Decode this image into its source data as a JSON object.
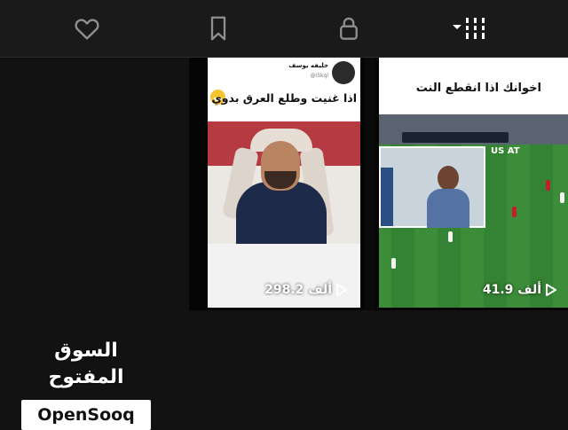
{
  "tabs": [
    {
      "icon": "heart-icon"
    },
    {
      "icon": "bookmark-icon"
    },
    {
      "icon": "lock-icon"
    },
    {
      "icon": "sort-columns-icon"
    }
  ],
  "colors": {
    "topbar": "#1a1a1a",
    "background": "#121212",
    "pitch": "#3b8d3a"
  },
  "videos": [
    {
      "views": "298.2 ألف",
      "tweet_author": "خليفه يوسف",
      "tweet_handle": "@i5kql",
      "tweet_text": "اذا غنيت وطلع العرق بدوي"
    },
    {
      "views": "41.9 ألف",
      "caption": "اخوانك اذا انقطع النت",
      "overlay": "US AT"
    }
  ],
  "watermark": {
    "arabic": "السوق المفتوح",
    "english": "OpenSooq"
  }
}
